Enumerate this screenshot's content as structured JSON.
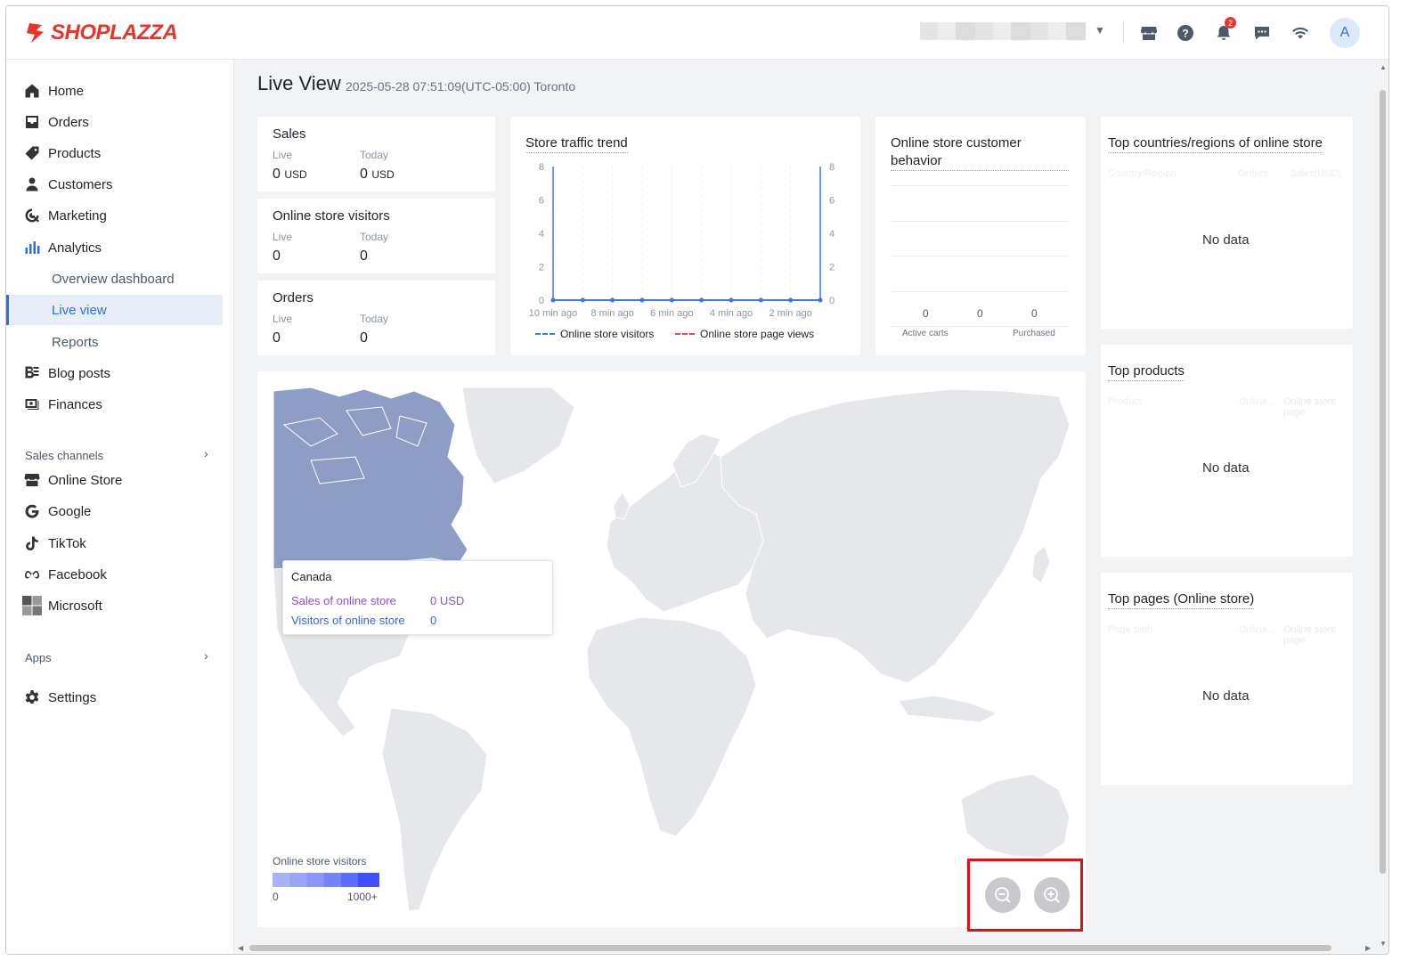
{
  "brand": {
    "name": "SHOPLAZZA",
    "color": "#e8342a"
  },
  "topbar": {
    "icons": [
      "store-icon",
      "help-icon",
      "bell-icon",
      "chat-icon",
      "wifi-icon"
    ],
    "notification_count": "2",
    "avatar_initial": "A"
  },
  "sidebar": {
    "items": [
      {
        "label": "Home",
        "icon": "home-icon"
      },
      {
        "label": "Orders",
        "icon": "orders-icon"
      },
      {
        "label": "Products",
        "icon": "tag-icon"
      },
      {
        "label": "Customers",
        "icon": "person-icon"
      },
      {
        "label": "Marketing",
        "icon": "marketing-icon"
      },
      {
        "label": "Analytics",
        "icon": "bar-chart-icon"
      }
    ],
    "analytics_sub": [
      "Overview dashboard",
      "Live view",
      "Reports"
    ],
    "items2": [
      {
        "label": "Blog posts",
        "icon": "blog-icon"
      },
      {
        "label": "Finances",
        "icon": "finance-icon"
      }
    ],
    "sales_channels_label": "Sales channels",
    "channels": [
      {
        "label": "Online Store",
        "icon": "store-icon"
      },
      {
        "label": "Google",
        "icon": "google-icon"
      },
      {
        "label": "TikTok",
        "icon": "tiktok-icon"
      },
      {
        "label": "Facebook",
        "icon": "meta-icon"
      },
      {
        "label": "Microsoft",
        "icon": "microsoft-icon"
      }
    ],
    "apps_label": "Apps",
    "settings_label": "Settings"
  },
  "page": {
    "title": "Live View",
    "timestamp": "2025-05-28 07:51:09(UTC-05:00) Toronto"
  },
  "metrics": [
    {
      "title": "Sales",
      "live_label": "Live",
      "today_label": "Today",
      "live_value": "0",
      "live_unit": "USD",
      "today_value": "0",
      "today_unit": "USD"
    },
    {
      "title": "Online store visitors",
      "live_label": "Live",
      "today_label": "Today",
      "live_value": "0",
      "today_value": "0"
    },
    {
      "title": "Orders",
      "live_label": "Live",
      "today_label": "Today",
      "live_value": "0",
      "today_value": "0"
    }
  ],
  "traffic": {
    "title": "Store traffic trend",
    "legend": [
      "Online store visitors",
      "Online store page views"
    ]
  },
  "behavior": {
    "title": "Online store customer behavior",
    "values": [
      "0",
      "0",
      "0"
    ],
    "labels": [
      "Active carts",
      "Purchased"
    ]
  },
  "top_countries": {
    "title": "Top countries/regions of online store",
    "headers": [
      "Country/Region",
      "Orders",
      "Sales(USD)"
    ],
    "no_data": "No data"
  },
  "top_products": {
    "title": "Top products",
    "headers": [
      "Product",
      "Online...",
      "Online store page"
    ],
    "no_data": "No data"
  },
  "top_pages": {
    "title": "Top pages (Online store)",
    "headers": [
      "Page path",
      "Online...",
      "Online store page"
    ],
    "no_data": "No data"
  },
  "map": {
    "tooltip": {
      "title": "Canada",
      "rows": [
        {
          "label": "Sales of online store",
          "value": "0 USD"
        },
        {
          "label": "Visitors of online store",
          "value": "0"
        }
      ]
    },
    "legend_title": "Online store visitors",
    "legend_min": "0",
    "legend_max": "1000+"
  },
  "chart_data": {
    "type": "line",
    "title": "Store traffic trend",
    "x": [
      "10 min ago",
      "9 min ago",
      "8 min ago",
      "7 min ago",
      "6 min ago",
      "5 min ago",
      "4 min ago",
      "3 min ago",
      "2 min ago",
      "1 min ago"
    ],
    "x_tick_labels": [
      "10 min ago",
      "8 min ago",
      "6 min ago",
      "4 min ago",
      "2 min ago"
    ],
    "series": [
      {
        "name": "Online store visitors",
        "values": [
          0,
          0,
          0,
          0,
          0,
          0,
          0,
          0,
          0,
          0
        ],
        "color": "#3b7be8"
      },
      {
        "name": "Online store page views",
        "values": [
          0,
          0,
          0,
          0,
          0,
          0,
          0,
          0,
          0,
          0
        ],
        "color": "#ea4a43"
      }
    ],
    "ylim": [
      0,
      8
    ],
    "y_ticks": [
      0,
      2,
      4,
      6,
      8
    ],
    "grid": true,
    "legend": "bottom"
  }
}
